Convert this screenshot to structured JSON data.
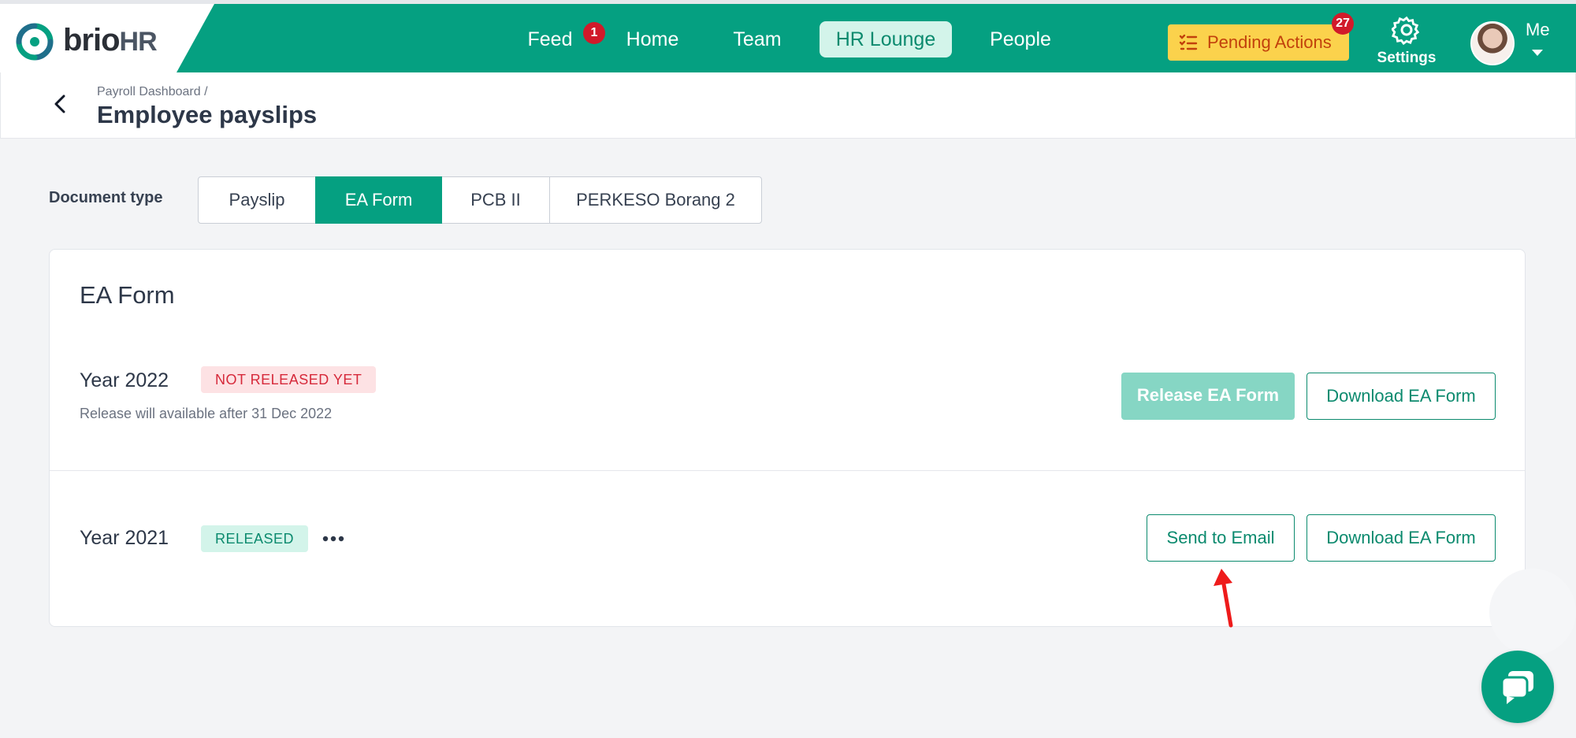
{
  "brand": {
    "name_part1": "brio",
    "name_part2": "HR"
  },
  "nav": {
    "items": [
      {
        "label": "Feed",
        "badge": "1"
      },
      {
        "label": "Home"
      },
      {
        "label": "Team"
      },
      {
        "label": "HR Lounge",
        "active": true
      },
      {
        "label": "People"
      }
    ],
    "pending_actions": {
      "label": "Pending Actions",
      "badge": "27"
    },
    "settings_label": "Settings",
    "user_label": "Me"
  },
  "header": {
    "breadcrumb": "Payroll Dashboard  /",
    "title": "Employee payslips"
  },
  "document_type": {
    "label": "Document type",
    "options": [
      "Payslip",
      "EA Form",
      "PCB II",
      "PERKESO Borang 2"
    ],
    "selected": "EA Form"
  },
  "card": {
    "title": "EA Form",
    "rows": [
      {
        "year": "Year 2022",
        "status": "NOT RELEASED YET",
        "note": "Release will available after 31 Dec 2022",
        "primary_button": "Release EA Form",
        "secondary_button": "Download EA Form"
      },
      {
        "year": "Year 2021",
        "status": "RELEASED",
        "primary_button": "Send to Email",
        "secondary_button": "Download EA Form"
      }
    ]
  },
  "colors": {
    "brand_green": "#05a081",
    "pending_yellow": "#fbd24c",
    "badge_red": "#d11a2a",
    "released_bg": "#d3f4ea",
    "not_released_bg": "#fde2e4"
  }
}
